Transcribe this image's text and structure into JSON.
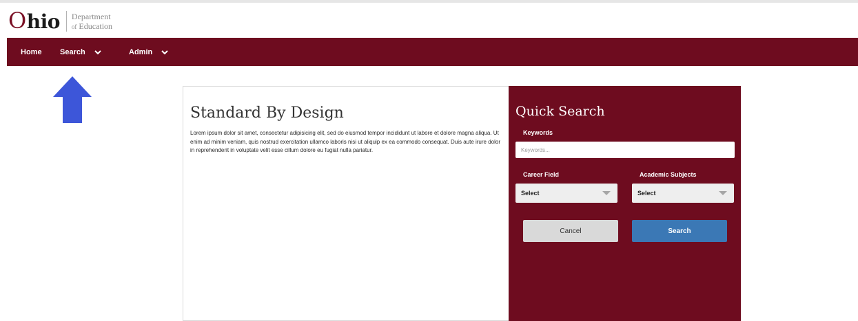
{
  "brand": {
    "logo_first_letter": "O",
    "logo_rest": "hio",
    "dept_line1": "Department",
    "dept_of": "of",
    "dept_line2": "Education"
  },
  "nav": {
    "home": "Home",
    "search": "Search",
    "admin": "Admin"
  },
  "main": {
    "title": "Standard By Design",
    "body": "Lorem ipsum dolor sit amet, consectetur adipisicing elit, sed do eiusmod tempor incididunt ut labore et dolore magna aliqua. Ut enim ad minim veniam, quis nostrud exercitation ullamco laboris nisi ut aliquip ex ea commodo consequat. Duis aute irure dolor in reprehenderit in voluptate velit esse cillum dolore eu fugiat nulla pariatur."
  },
  "quick_search": {
    "title": "Quick Search",
    "keywords_label": "Keywords",
    "keywords_placeholder": "Keywords...",
    "keywords_value": "",
    "career_field_label": "Career Field",
    "career_field_value": "Select",
    "academic_subjects_label": "Academic Subjects",
    "academic_subjects_value": "Select",
    "cancel_label": "Cancel",
    "search_label": "Search"
  },
  "icons": {
    "annotation_arrow": "arrow-up-icon",
    "nav_chevron": "chevron-down-icon",
    "select_caret": "caret-down-icon"
  },
  "colors": {
    "brand_maroon": "#6e0c1f",
    "search_button_blue": "#3b78b5",
    "annotation_arrow_blue": "#3d56d9"
  }
}
